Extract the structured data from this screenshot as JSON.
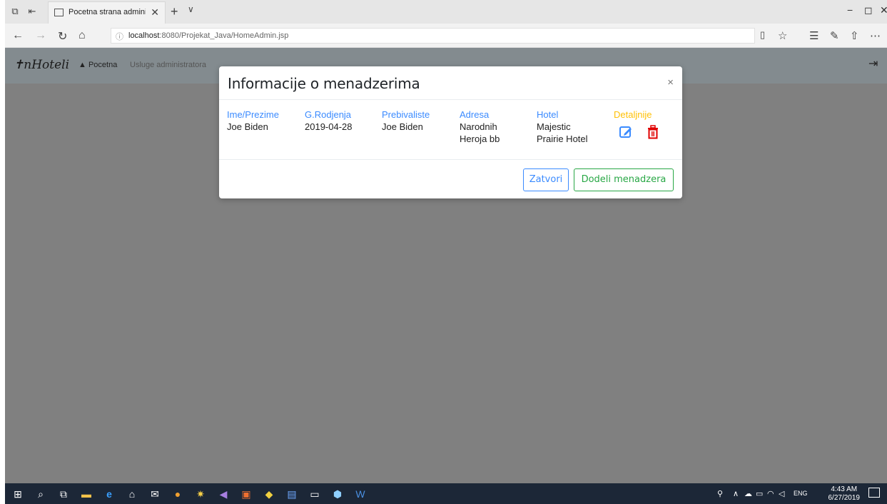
{
  "browser": {
    "tab_title": "Pocetna strana administ",
    "tab_close": "✕",
    "new_tab": "+",
    "tab_menu": "∨",
    "url_host": "localhost",
    "url_rest": ":8080/Projekat_Java/HomeAdmin.jsp",
    "window_controls": {
      "minimize": "−",
      "maximize": "◻",
      "close": "✕"
    }
  },
  "app": {
    "brand": "nHoteli",
    "nav_home": "Pocetna",
    "nav_services": "Usluge administratora",
    "logout_icon": "logout-icon"
  },
  "modal": {
    "title": "Informacije o menadzerima",
    "close": "×",
    "columns": {
      "name_header": "Ime/Prezime",
      "birth_header": "G.Rodjenja",
      "residence_header": "Prebivaliste",
      "address_header": "Adresa",
      "hotel_header": "Hotel",
      "details_header": "Detaljnije"
    },
    "row": {
      "name": "Joe Biden",
      "birth": "2019-04-28",
      "residence": "Joe Biden",
      "address_1": "Narodnih",
      "address_2": "Heroja bb",
      "hotel_1": "Majestic",
      "hotel_2": "Prairie Hotel"
    },
    "colors": {
      "edit": "#3b8bff",
      "delete": "#e00000"
    },
    "buttons": {
      "close": "Zatvori",
      "assign": "Dodeli menadzera"
    }
  },
  "taskbar": {
    "lang": "ENG",
    "time": "4:43 AM",
    "date": "6/27/2019"
  }
}
